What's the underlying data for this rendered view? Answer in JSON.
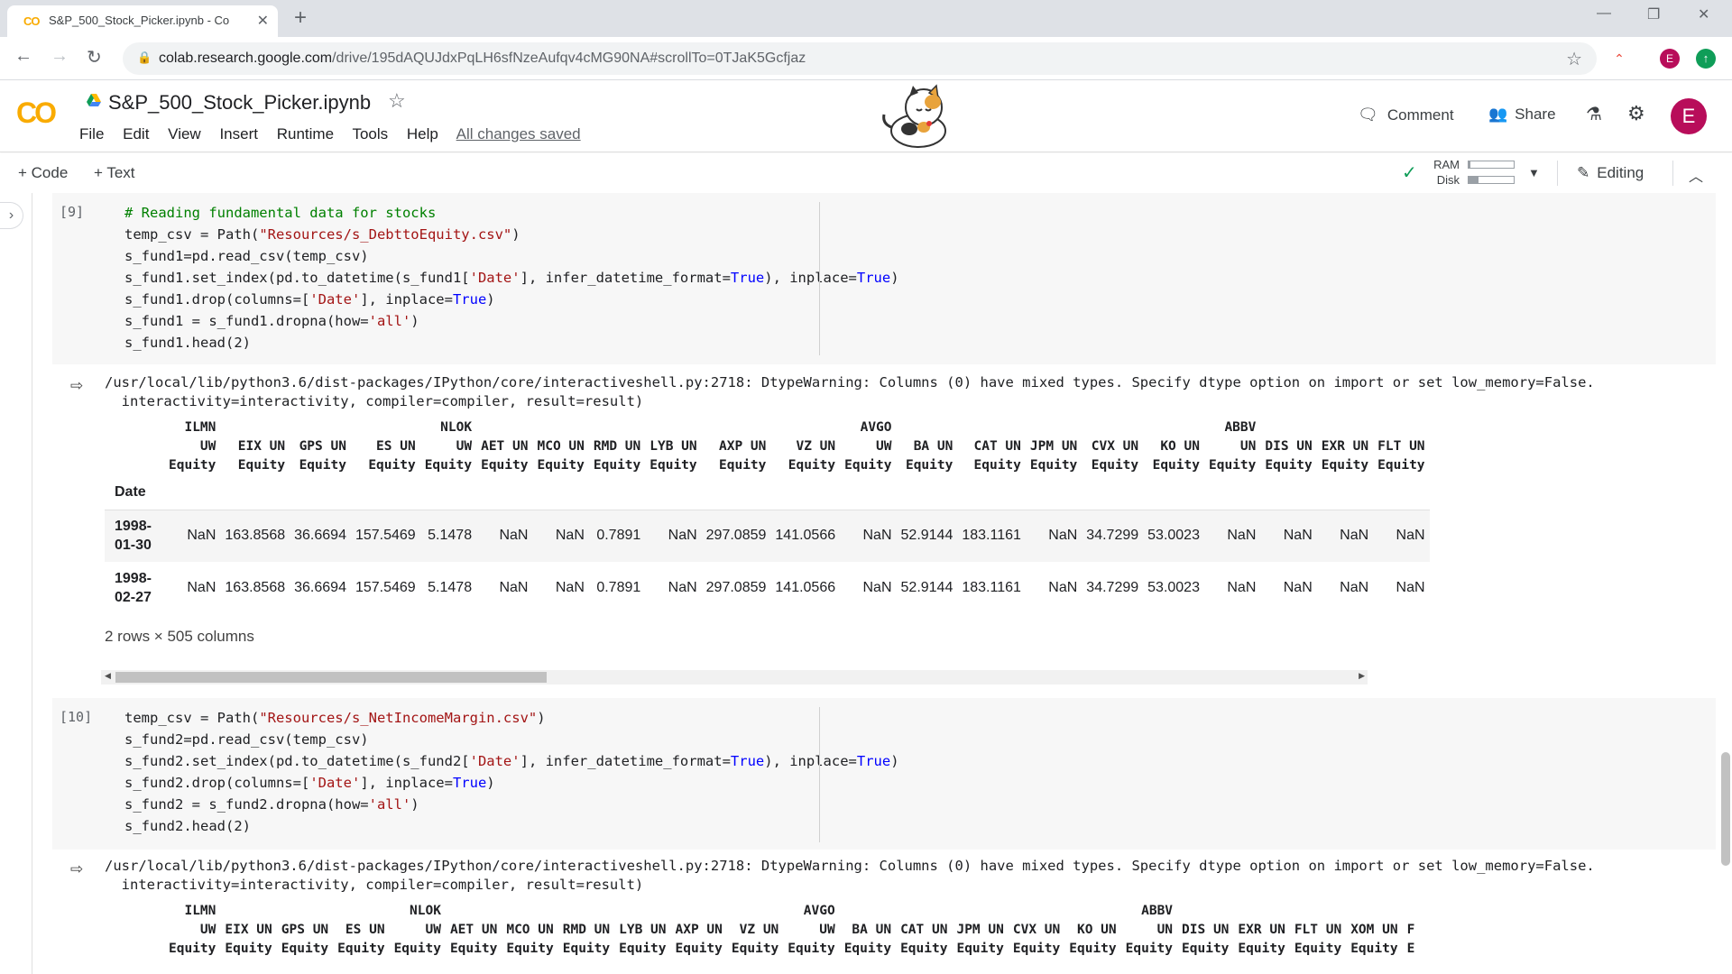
{
  "browser": {
    "tab_title": "S&P_500_Stock_Picker.ipynb - Co",
    "url_host": "colab.research.google.com",
    "url_path": "/drive/195dAQUJdxPqLH6sfNzeAufqv4cMG90NA#scrollTo=0TJaK5Gcfjaz",
    "profile_initial": "E"
  },
  "colab": {
    "logo": "CO",
    "notebook_title": "S&P_500_Stock_Picker.ipynb",
    "menu": [
      "File",
      "Edit",
      "View",
      "Insert",
      "Runtime",
      "Tools",
      "Help"
    ],
    "save_status": "All changes saved",
    "comment_label": "Comment",
    "share_label": "Share",
    "avatar_initial": "E"
  },
  "toolbar": {
    "code_label": "Code",
    "text_label": "Text",
    "ram_label": "RAM",
    "disk_label": "Disk",
    "ram_fill": 0.04,
    "disk_fill": 0.22,
    "editing_label": "Editing"
  },
  "cells": [
    {
      "exec_count": "[9]",
      "code_lines": [
        "# Reading fundamental data for stocks",
        "temp_csv = Path(\"Resources/s_DebttoEquity.csv\")",
        "s_fund1=pd.read_csv(temp_csv)",
        "s_fund1.set_index(pd.to_datetime(s_fund1['Date'], infer_datetime_format=True), inplace=True)",
        "s_fund1.drop(columns=['Date'], inplace=True)",
        "s_fund1 = s_fund1.dropna(how='all')",
        "s_fund1.head(2)"
      ],
      "warning": [
        "/usr/local/lib/python3.6/dist-packages/IPython/core/interactiveshell.py:2718: DtypeWarning: Columns (0) have mixed types. Specify dtype option on import or set low_memory=False.",
        "  interactivity=interactivity, compiler=compiler, result=result)"
      ],
      "table": {
        "columns": [
          "ILMN\nUW\nEquity",
          "EIX UN\nEquity",
          "GPS UN\nEquity",
          "ES UN\nEquity",
          "NLOK\nUW\nEquity",
          "AET UN\nEquity",
          "MCO UN\nEquity",
          "RMD UN\nEquity",
          "LYB UN\nEquity",
          "AXP UN\nEquity",
          "VZ UN\nEquity",
          "AVGO\nUW\nEquity",
          "BA UN\nEquity",
          "CAT UN\nEquity",
          "JPM UN\nEquity",
          "CVX UN\nEquity",
          "KO UN\nEquity",
          "ABBV\nUN\nEquity",
          "DIS UN\nEquity",
          "EXR UN\nEquity",
          "FLT UN\nEquity"
        ],
        "index_name": "Date",
        "rows": [
          {
            "index": "1998-\n01-30",
            "values": [
              "NaN",
              "163.8568",
              "36.6694",
              "157.5469",
              "5.1478",
              "NaN",
              "NaN",
              "0.7891",
              "NaN",
              "297.0859",
              "141.0566",
              "NaN",
              "52.9144",
              "183.1161",
              "NaN",
              "34.7299",
              "53.0023",
              "NaN",
              "NaN",
              "NaN",
              "NaN"
            ]
          },
          {
            "index": "1998-\n02-27",
            "values": [
              "NaN",
              "163.8568",
              "36.6694",
              "157.5469",
              "5.1478",
              "NaN",
              "NaN",
              "0.7891",
              "NaN",
              "297.0859",
              "141.0566",
              "NaN",
              "52.9144",
              "183.1161",
              "NaN",
              "34.7299",
              "53.0023",
              "NaN",
              "NaN",
              "NaN",
              "NaN"
            ]
          }
        ],
        "shape": "2 rows × 505 columns"
      }
    },
    {
      "exec_count": "[10]",
      "code_lines": [
        "temp_csv = Path(\"Resources/s_NetIncomeMargin.csv\")",
        "s_fund2=pd.read_csv(temp_csv)",
        "s_fund2.set_index(pd.to_datetime(s_fund2['Date'], infer_datetime_format=True), inplace=True)",
        "s_fund2.drop(columns=['Date'], inplace=True)",
        "s_fund2 = s_fund2.dropna(how='all')",
        "s_fund2.head(2)"
      ],
      "warning": [
        "/usr/local/lib/python3.6/dist-packages/IPython/core/interactiveshell.py:2718: DtypeWarning: Columns (0) have mixed types. Specify dtype option on import or set low_memory=False.",
        "  interactivity=interactivity, compiler=compiler, result=result)"
      ],
      "table": {
        "columns": [
          "ILMN\nUW\nEquity",
          "EIX UN\nEquity",
          "GPS UN\nEquity",
          "ES UN\nEquity",
          "NLOK\nUW\nEquity",
          "AET UN\nEquity",
          "MCO UN\nEquity",
          "RMD UN\nEquity",
          "LYB UN\nEquity",
          "AXP UN\nEquity",
          "VZ UN\nEquity",
          "AVGO\nUW\nEquity",
          "BA UN\nEquity",
          "CAT UN\nEquity",
          "JPM UN\nEquity",
          "CVX UN\nEquity",
          "KO UN\nEquity",
          "ABBV\nUN\nEquity",
          "DIS UN\nEquity",
          "EXR UN\nEquity",
          "FLT UN\nEquity",
          "XOM UN\nEquity",
          "F\nE"
        ]
      }
    }
  ],
  "colors": {
    "accent_orange": "#f9ab00",
    "avatar": "#b80d5a",
    "check_green": "#0f9d58",
    "code_comment": "#008000",
    "code_string": "#a31515",
    "code_keyword": "#0000ff"
  }
}
